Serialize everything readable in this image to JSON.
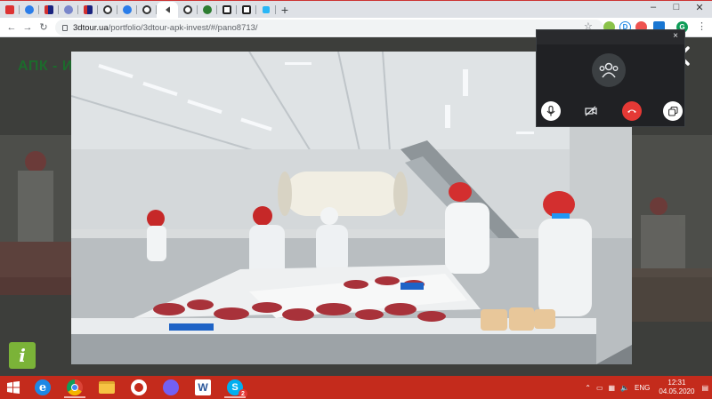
{
  "browser": {
    "new_tab_symbol": "+",
    "window_controls": [
      "–",
      "□",
      "✕"
    ],
    "url_domain": "3dtour.ua",
    "url_path": "/portfolio/3dtour-apk-invest/#/pano8713/",
    "profile_initial": "G"
  },
  "page": {
    "logo_text": "АПК - ИН",
    "info_label": "i"
  },
  "call_panel": {
    "close_label": "×",
    "end_call_color": "#e53935"
  },
  "taskbar": {
    "language": "ENG",
    "time": "12:31",
    "date": "04.05.2020",
    "skype_badge": "2",
    "accent_color": "#c42b1c"
  }
}
